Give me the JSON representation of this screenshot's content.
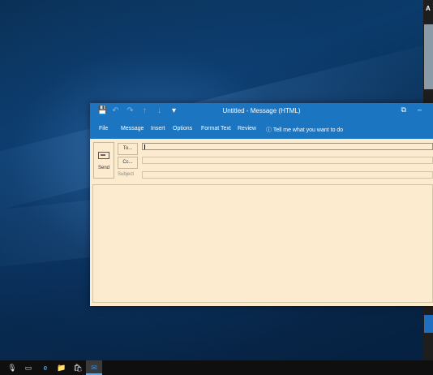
{
  "window": {
    "title": "Untitled - Message (HTML)",
    "qat": {
      "save_icon": "💾",
      "undo_icon": "↶",
      "redo_icon": "↷",
      "up_icon": "↑",
      "down_icon": "↓",
      "more_icon": "▾"
    },
    "controls": {
      "restore_icon": "⧉",
      "minimize_icon": "–"
    }
  },
  "ribbon": {
    "tabs": [
      "File",
      "Message",
      "Insert",
      "Options",
      "Format Text",
      "Review"
    ],
    "tell_me": "ⓘ Tell me what you want to do"
  },
  "compose": {
    "send_label": "Send",
    "to_label": "To...",
    "cc_label": "Cc...",
    "subject_label": "Subject",
    "to_value": "",
    "cc_value": "",
    "subject_value": ""
  },
  "side_panel": {
    "title": "A"
  },
  "taskbar": {
    "icons": [
      "🎙",
      "▭",
      "e",
      "📁",
      "🛍"
    ]
  }
}
